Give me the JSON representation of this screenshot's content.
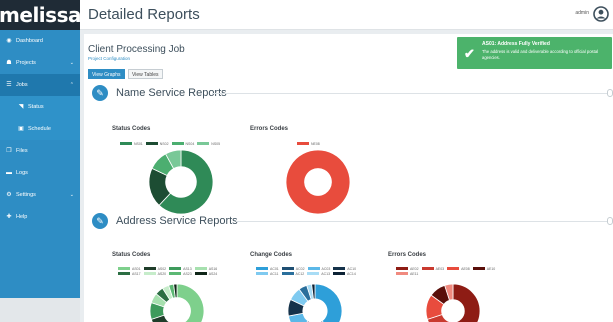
{
  "brand": {
    "logo": "melissa"
  },
  "header": {
    "title": "Detailed Reports",
    "user": "admin",
    "avatar_icon": "user-circle-icon"
  },
  "sidebar": {
    "items": [
      {
        "label": "Dashboard",
        "icon": "dashboard-icon"
      },
      {
        "label": "Projects",
        "icon": "projects-icon"
      },
      {
        "label": "Jobs",
        "icon": "jobs-icon"
      },
      {
        "label": "Status",
        "icon": "rss-icon"
      },
      {
        "label": "Schedule",
        "icon": "calendar-icon"
      },
      {
        "label": "Files",
        "icon": "files-icon"
      },
      {
        "label": "Logs",
        "icon": "logs-icon"
      },
      {
        "label": "Settings",
        "icon": "settings-icon"
      },
      {
        "label": "Help",
        "icon": "help-icon"
      }
    ]
  },
  "job": {
    "title": "Client Processing Job",
    "subtitle": "Project Configuration",
    "view_graphs": "View Graphs",
    "view_tables": "View Tables"
  },
  "toast": {
    "title": "AS01: Address Fully Verified",
    "message": "The address is valid and deliverable according to official postal agencies.",
    "color": "#4cb36b"
  },
  "sections": {
    "name": {
      "title": "Name Service Reports"
    },
    "address": {
      "title": "Address Service Reports"
    }
  },
  "cards": {
    "name_status": {
      "title": "Status Codes",
      "legend": [
        "NS01",
        "NS02",
        "NS04",
        "NS05"
      ]
    },
    "name_errors": {
      "title": "Errors Codes",
      "legend": [
        "NE08"
      ]
    },
    "addr_status": {
      "title": "Status Codes",
      "legend": [
        "AS01",
        "AS02",
        "AS13",
        "AS16",
        "AS17",
        "AS20",
        "AS23",
        "AS24"
      ]
    },
    "addr_change": {
      "title": "Change Codes",
      "legend": [
        "AC01",
        "AC02",
        "AC03",
        "AC10",
        "AC11",
        "AC12",
        "AC13",
        "AC14"
      ]
    },
    "addr_errors": {
      "title": "Errors Codes",
      "legend": [
        "AE02",
        "AE03",
        "AE08",
        "AE10",
        "AE11"
      ]
    }
  },
  "chart_data": [
    {
      "type": "pie",
      "title": "Status Codes",
      "categories": [
        "NS01",
        "NS02",
        "NS04",
        "NS05"
      ],
      "values": [
        62,
        20,
        10,
        8
      ],
      "colors": [
        "#2f8a57",
        "#1d4d33",
        "#4cae70",
        "#79c897"
      ]
    },
    {
      "type": "pie",
      "title": "Errors Codes",
      "categories": [
        "NE08"
      ],
      "values": [
        100
      ],
      "colors": [
        "#e84c3d"
      ]
    },
    {
      "type": "pie",
      "title": "Status Codes",
      "categories": [
        "AS01",
        "AS02",
        "AS13",
        "AS16",
        "AS17",
        "AS20",
        "AS23",
        "AS24"
      ],
      "values": [
        55,
        15,
        10,
        6,
        5,
        4,
        3,
        2
      ],
      "colors": [
        "#7ed08c",
        "#1f3d2a",
        "#3e9b5c",
        "#a6e0ae",
        "#2c6e43",
        "#c6ecca",
        "#5cb874",
        "#0f2618"
      ]
    },
    {
      "type": "pie",
      "title": "Change Codes",
      "categories": [
        "AC01",
        "AC02",
        "AC03",
        "AC10",
        "AC11",
        "AC12",
        "AC13",
        "AC14"
      ],
      "values": [
        40,
        20,
        12,
        10,
        8,
        5,
        3,
        2
      ],
      "colors": [
        "#2e9fd9",
        "#1f4f73",
        "#5bb8e8",
        "#15324a",
        "#7fcaf0",
        "#2a6f9c",
        "#a8dcf5",
        "#0c2235"
      ]
    },
    {
      "type": "pie",
      "title": "Errors Codes",
      "categories": [
        "AE02",
        "AE03",
        "AE08",
        "AE10",
        "AE11"
      ],
      "values": [
        50,
        20,
        15,
        10,
        5
      ],
      "colors": [
        "#8e1c14",
        "#c93a2f",
        "#e84c3d",
        "#5a0f0a",
        "#f08a7f"
      ]
    }
  ]
}
